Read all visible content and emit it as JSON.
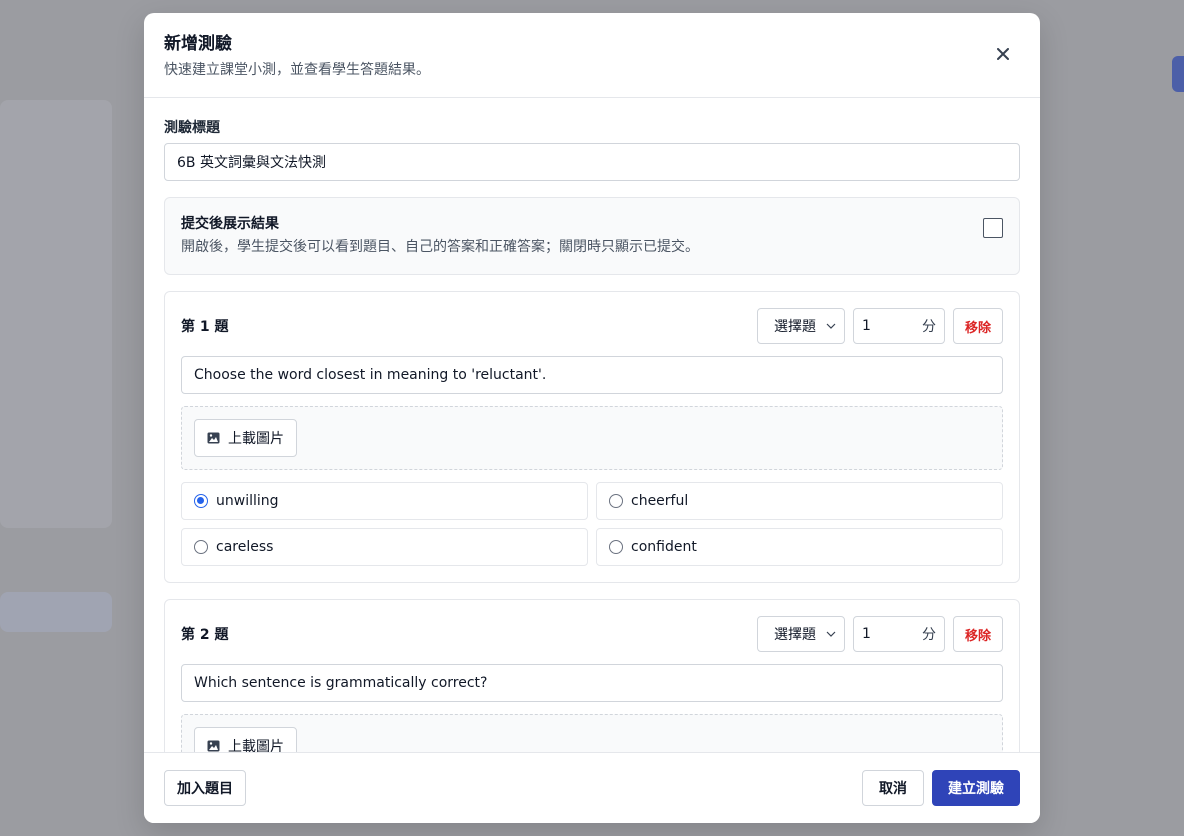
{
  "modal": {
    "title": "新增測驗",
    "subtitle": "快速建立課堂小測，並查看學生答題結果。"
  },
  "form": {
    "title_label": "測驗標題",
    "title_value": "6B 英文詞彙與文法快測",
    "show_results": {
      "title": "提交後展示結果",
      "description": "開啟後，學生提交後可以看到題目、自己的答案和正確答案；關閉時只顯示已提交。",
      "checked": false
    }
  },
  "questions": [
    {
      "title": "第 1 題",
      "type": "選擇題",
      "score": "1",
      "unit": "分",
      "remove_label": "移除",
      "text": "Choose the word closest in meaning to 'reluctant'.",
      "upload_label": "上載圖片",
      "options": [
        "unwilling",
        "cheerful",
        "careless",
        "confident"
      ],
      "selected_index": 0
    },
    {
      "title": "第 2 題",
      "type": "選擇題",
      "score": "1",
      "unit": "分",
      "remove_label": "移除",
      "text": "Which sentence is grammatically correct?",
      "upload_label": "上載圖片"
    }
  ],
  "footer": {
    "add_question": "加入題目",
    "cancel": "取消",
    "create": "建立測驗"
  },
  "colors": {
    "primary": "#2f44b8",
    "danger": "#dc2626",
    "radio_selected": "#2563eb"
  }
}
